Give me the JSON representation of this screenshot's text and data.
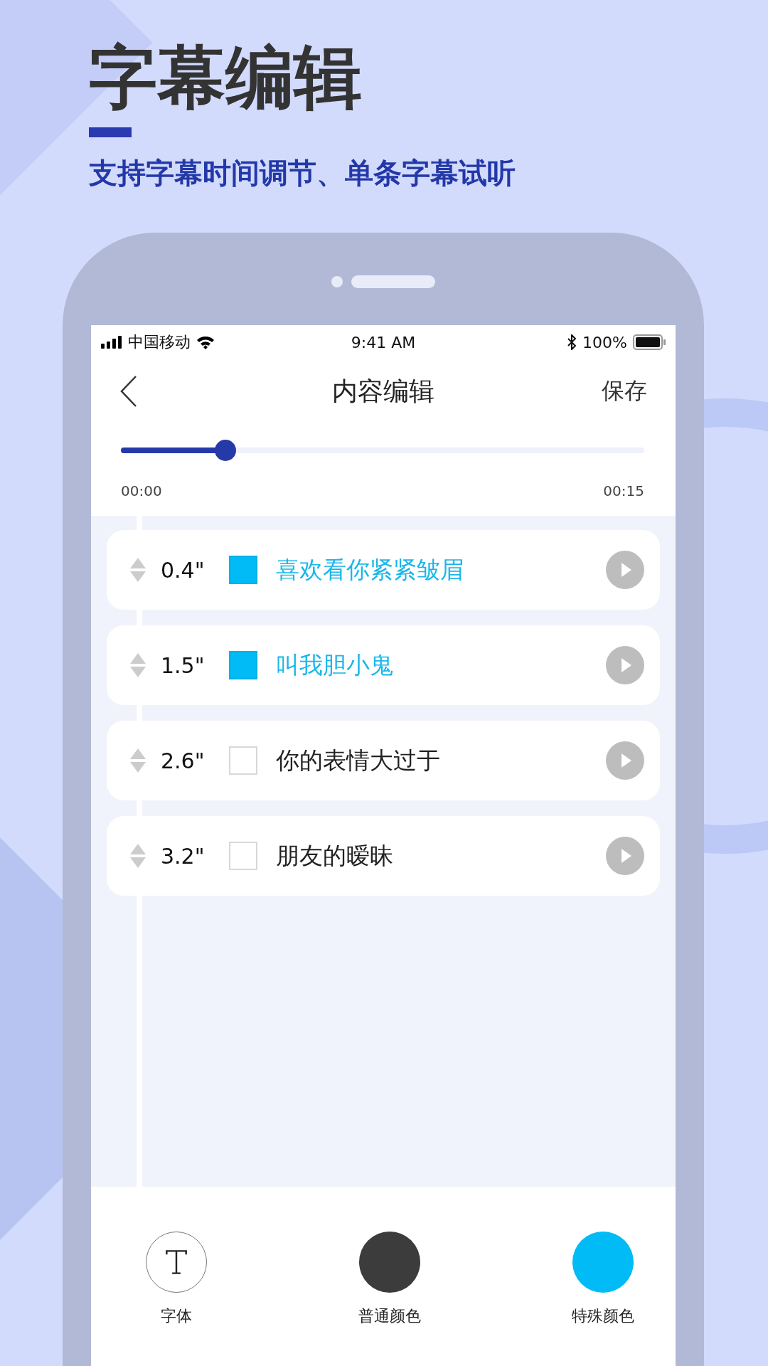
{
  "header": {
    "title": "字幕编辑",
    "subtitle": "支持字幕时间调节、单条字幕试听"
  },
  "status_bar": {
    "carrier": "中国移动",
    "time": "9:41 AM",
    "battery": "100%"
  },
  "nav": {
    "title": "内容编辑",
    "action": "保存"
  },
  "player": {
    "level": 0.2,
    "start": "00:00",
    "end": "00:15"
  },
  "subtitles": [
    {
      "duration": "0.4\"",
      "text": "喜欢看你紧紧皱眉",
      "checked": true
    },
    {
      "duration": "1.5\"",
      "text": "叫我胆小鬼",
      "checked": true
    },
    {
      "duration": "2.6\"",
      "text": "你的表情大过于",
      "checked": false
    },
    {
      "duration": "3.2\"",
      "text": "朋友的暧昧",
      "checked": false
    }
  ],
  "toolbar": [
    {
      "kind": "font",
      "label": "字体"
    },
    {
      "kind": "color",
      "label": "普通颜色",
      "color": "#3c3c3c"
    },
    {
      "kind": "color",
      "label": "特殊颜色",
      "color": "#00bbf5"
    }
  ]
}
